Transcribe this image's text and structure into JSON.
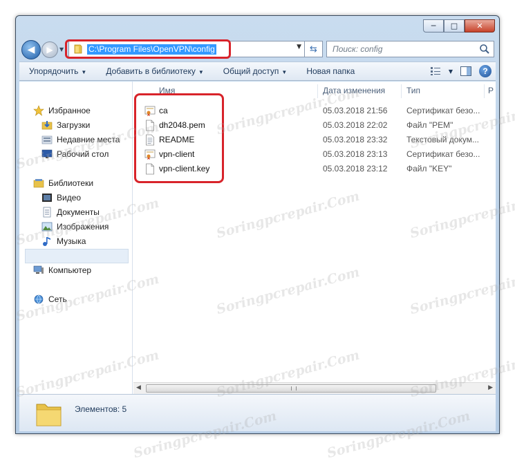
{
  "window": {
    "controls": {
      "minimize": "─",
      "maximize": "□",
      "close": "✕"
    }
  },
  "navbar": {
    "back_icon": "arrow-left-icon",
    "forward_icon": "arrow-right-icon",
    "address": "C:\\Program Files\\OpenVPN\\config",
    "search_placeholder": "Поиск: config"
  },
  "toolbar": {
    "organize": "Упорядочить",
    "add_to_library": "Добавить в библиотеку",
    "share": "Общий доступ",
    "new_folder": "Новая папка",
    "dropdown_arrow": "▼"
  },
  "sidebar": {
    "favorites": "Избранное",
    "downloads": "Загрузки",
    "recent": "Недавние места",
    "desktop": "Рабочий стол",
    "libraries": "Библиотеки",
    "video": "Видео",
    "documents": "Документы",
    "images": "Изображения",
    "music": "Музыка",
    "computer": "Компьютер",
    "network": "Сеть"
  },
  "columns": {
    "name": "Имя",
    "date": "Дата изменения",
    "type": "Тип",
    "size": "Р"
  },
  "files": [
    {
      "name": "ca",
      "date": "05.03.2018 21:56",
      "type": "Сертификат безо...",
      "icon": "certificate-icon"
    },
    {
      "name": "dh2048.pem",
      "date": "05.03.2018 22:02",
      "type": "Файл \"PEM\"",
      "icon": "file-icon"
    },
    {
      "name": "README",
      "date": "05.03.2018 23:32",
      "type": "Текстовый докум...",
      "icon": "text-file-icon"
    },
    {
      "name": "vpn-client",
      "date": "05.03.2018 23:13",
      "type": "Сертификат безо...",
      "icon": "certificate-icon"
    },
    {
      "name": "vpn-client.key",
      "date": "05.03.2018 23:12",
      "type": "Файл \"KEY\"",
      "icon": "file-icon"
    }
  ],
  "status": {
    "items_count": "Элементов: 5"
  },
  "watermark": "Soringpcrepair.Com",
  "colors": {
    "highlight": "#d8232a",
    "selection": "#3399ff",
    "toolbar_text": "#1e395b"
  }
}
